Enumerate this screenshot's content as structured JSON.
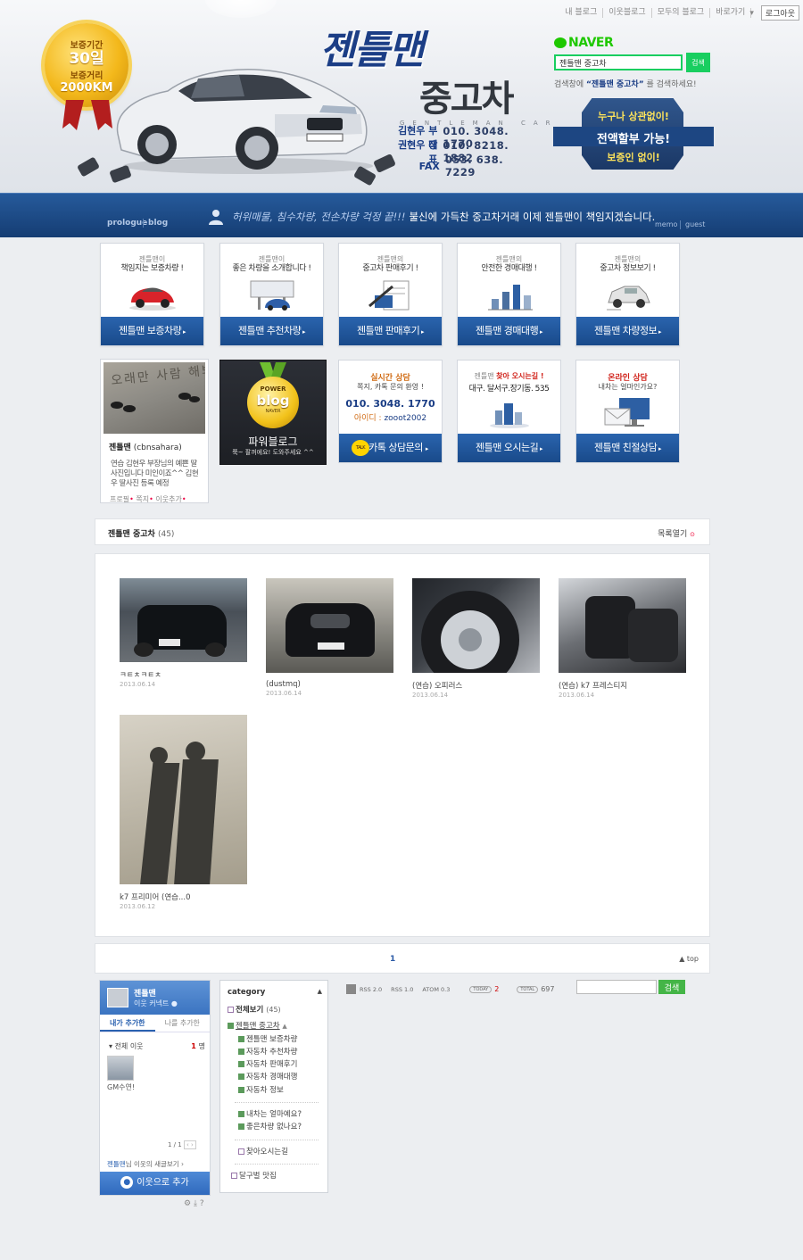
{
  "topnav": {
    "items": [
      "내 블로그",
      "이웃블로그",
      "모두의 블로그",
      "바로가기"
    ],
    "logout": "로그아웃"
  },
  "medal": {
    "l1": "보증기간",
    "l2": "30일",
    "l3": "보증거리",
    "l4": "2000KM"
  },
  "brand": {
    "title1": "젠틀맨",
    "title2": "중고차",
    "subtitle": "GENTLEMAN CAR"
  },
  "contacts": [
    {
      "name": "김현우 부장",
      "value": "010. 3048. 1770"
    },
    {
      "name": "권현우 대표",
      "value": "010. 8218. 1882"
    },
    {
      "name": "FAX",
      "value": "053. 638. 7229"
    }
  ],
  "naver": {
    "logo": "NAVER",
    "query": "젠틀맨 중고차",
    "button": "검색",
    "tip_pre": "검색창에 ",
    "tip_key": "“젠틀맨 중고차”",
    "tip_post": " 를 검색하세요!"
  },
  "badge": {
    "t1": "누구나 상관없이!",
    "t2": "전액할부 가능!",
    "t3": "보증인 없이!"
  },
  "navbar": {
    "prologue": "prologue",
    "blog": "blog",
    "msg_hl": "허위매물, 침수차량, 전손차량 걱정 끝!!!",
    "msg": "불신에 가득찬 중고차거래 이제 젠틀맨이 책임지겠습니다.",
    "memo": "memo",
    "guest": "guest"
  },
  "cards": [
    {
      "small": "젠틀맨이",
      "title": "책임지는 보증차량 !",
      "button": "젠틀맨 보증차량"
    },
    {
      "small": "젠틀맨이",
      "title": "좋은 차량을 소개합니다 !",
      "button": "젠틀맨 추천차량"
    },
    {
      "small": "젠틀맨의",
      "title": "중고차 판매후기 !",
      "button": "젠틀맨 판매후기"
    },
    {
      "small": "젠틀맨의",
      "title": "안전한 경매대행 !",
      "button": "젠틀맨 경매대행"
    },
    {
      "small": "젠틀맨의",
      "title": "중고차 정보보기 !",
      "button": "젠틀맨 차량정보"
    }
  ],
  "profile": {
    "name": "젠틀맨",
    "id": "(cbnsahara)",
    "desc": "연습 김현우 부장님의 예쁜 딸 사진입니다 미인이죠^^ 김현우 딸사진 등록 예정",
    "links": [
      "프로필",
      "쪽지",
      "이웃추가"
    ],
    "sand_text": "오래만 사람 해봐"
  },
  "powerblog": {
    "p1": "POWER",
    "p2": "blog",
    "p3": "NAVER",
    "t1": "파워블로그",
    "t2": "쭉~ 팔꺼에요! 도와주세요 ^^"
  },
  "counsel": {
    "top": "실시간 상담",
    "sub": "쪽지, 카톡 문의 환영 !",
    "phone": "010. 3048. 1770",
    "id_label": "아이디 :",
    "id": "zooot2002",
    "button": "카톡 상담문의",
    "talk": "TALK"
  },
  "directions": {
    "small_pre": "젠틀맨 ",
    "small_hl": "찾아 오시는길 !",
    "addr": "대구. 달서구.장기동. 535",
    "button": "젠틀맨 오시는길"
  },
  "online": {
    "top": "온라인 상담",
    "sub": "내차는 얼마인가요?",
    "button": "젠틀맨 친절상담"
  },
  "list": {
    "title": "젠틀맨 중고차",
    "count": "(45)",
    "open": "목록열기"
  },
  "posts": [
    {
      "title": "ㅋㅌㅊㅋㅌㅊ",
      "date": "2013.06.14"
    },
    {
      "title": "(dustmq)",
      "date": "2013.06.14"
    },
    {
      "title": "(연습) 오피러스",
      "date": "2013.06.14"
    },
    {
      "title": "(연습) k7 프레스티지",
      "date": "2013.06.14"
    },
    {
      "title": "k7 프리미어 (연습...0",
      "date": "2013.06.12"
    }
  ],
  "pager": {
    "page": "1",
    "top": "▲ top"
  },
  "neighbor": {
    "name": "젠틀맨",
    "connect": "이웃 커넥트",
    "tab1": "내가 추가한",
    "tab2": "나를 추가한",
    "all": "전체 이웃",
    "count": "1",
    "count_unit": "명",
    "thumb": "GM수연!",
    "page": "1 / 1",
    "news_name": "젠틀맨",
    "news": "님 이웃의 새글보기 ›",
    "add": "이웃으로 추가"
  },
  "category": {
    "title": "category",
    "all": "전체보기",
    "all_count": "(45)",
    "items": [
      "젠틀맨 중고차",
      "젠틀맨 보증차량",
      "자동차 추천차량",
      "자동차 판매후기",
      "자동차 경매대행",
      "자동차 정보"
    ],
    "items2": [
      "내차는 얼마예요?",
      "좋은차량 없나요?"
    ],
    "items3": [
      "찾아오시는길"
    ],
    "items4": [
      "달구벌 맛집"
    ]
  },
  "stats": {
    "rss2": "RSS 2.0",
    "rss1": "RSS 1.0",
    "atom": "ATOM 0.3",
    "today_label": "TODAY",
    "today": "2",
    "total_label": "TOTAL",
    "total": "697"
  },
  "search2": {
    "button": "검색"
  }
}
